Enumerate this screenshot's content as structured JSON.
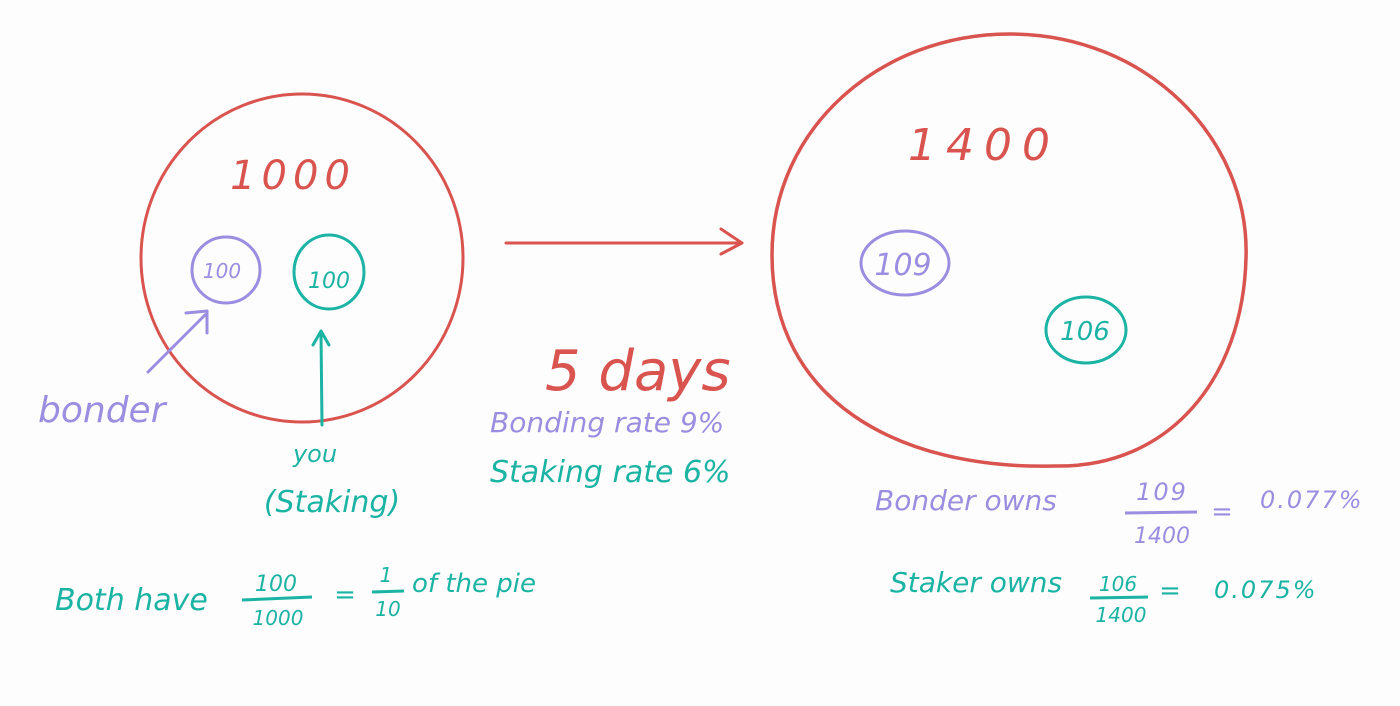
{
  "colors": {
    "red": "#d9534f",
    "purple": "#9b8ee0",
    "teal": "#1bb3a3"
  },
  "before": {
    "total": "1000",
    "bonder_amount": "100",
    "staker_amount": "100",
    "bonder_label": "bonder",
    "you_label": "you",
    "staking_label": "(Staking)",
    "summary": {
      "prefix": "Both have",
      "frac1_num": "100",
      "frac1_den": "1000",
      "equals": "=",
      "frac2_num": "1",
      "frac2_den": "10",
      "suffix": "of the pie"
    }
  },
  "transition": {
    "duration": "5 days",
    "bonding_rate": "Bonding rate 9%",
    "staking_rate": "Staking rate 6%"
  },
  "after": {
    "total": "1400",
    "bonder_amount": "109",
    "staker_amount": "106",
    "bonder_result": {
      "prefix": "Bonder owns",
      "num": "109",
      "den": "1400",
      "equals": "=",
      "value": "0.077%"
    },
    "staker_result": {
      "prefix": "Staker owns",
      "num": "106",
      "den": "1400",
      "equals": "=",
      "value": "0.075%"
    }
  }
}
